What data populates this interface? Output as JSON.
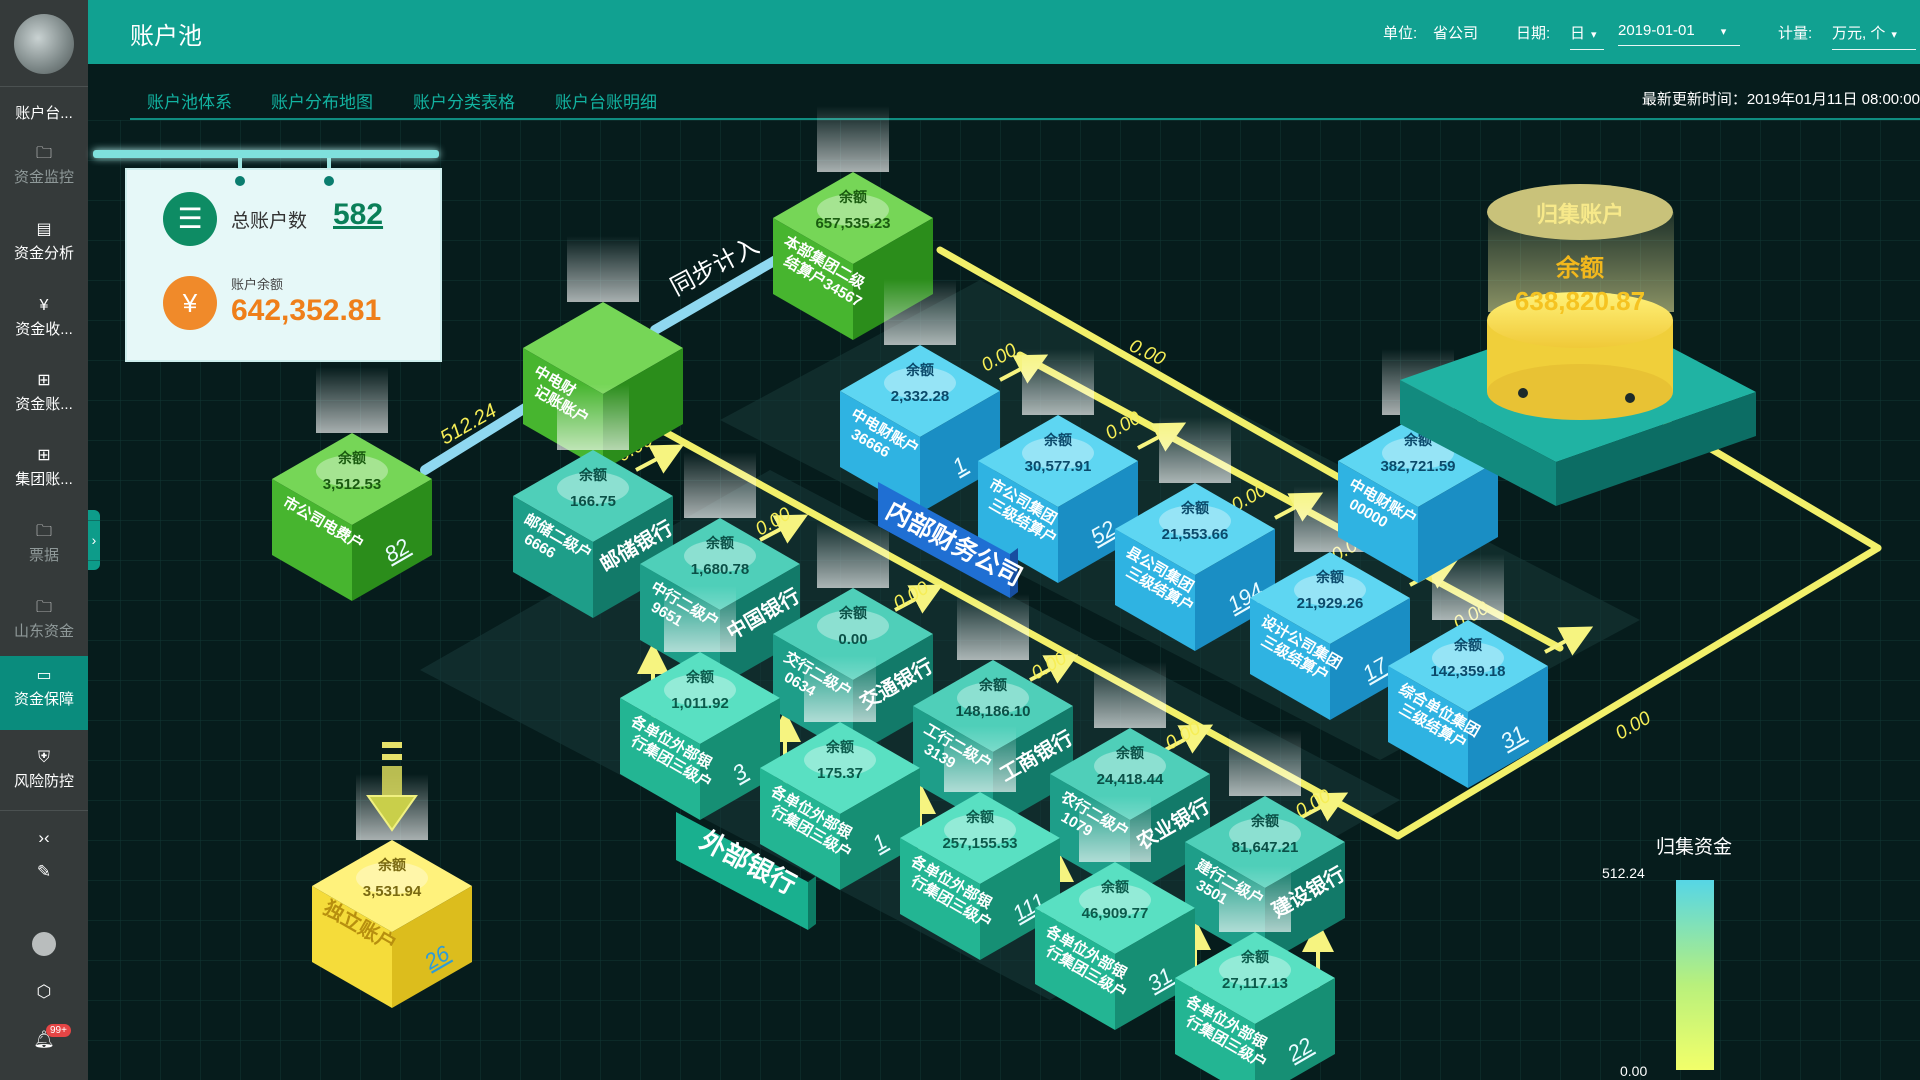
{
  "header": {
    "title": "账户池",
    "unit_label": "单位:",
    "unit_value": "省公司",
    "date_label": "日期:",
    "date_granularity": "日",
    "date_value": "2019-01-01",
    "measure_label": "计量:",
    "measure_value": "万元, 个"
  },
  "sidebar": {
    "items": [
      {
        "label": "账户台...",
        "icon": "ledger-icon",
        "active": false,
        "dim": false
      },
      {
        "label": "资金监控",
        "icon": "folder-icon",
        "active": false,
        "dim": true
      },
      {
        "label": "资金分析",
        "icon": "analysis-icon",
        "active": false,
        "dim": false
      },
      {
        "label": "资金收...",
        "icon": "money-icon",
        "active": false,
        "dim": false
      },
      {
        "label": "资金账...",
        "icon": "hierarchy-icon",
        "active": false,
        "dim": false
      },
      {
        "label": "集团账...",
        "icon": "hierarchy-icon",
        "active": false,
        "dim": false
      },
      {
        "label": "票据",
        "icon": "folder-icon",
        "active": false,
        "dim": true
      },
      {
        "label": "山东资金",
        "icon": "folder-icon",
        "active": false,
        "dim": true
      },
      {
        "label": "资金保障",
        "icon": "card-icon",
        "active": true,
        "dim": false
      },
      {
        "label": "风险防控",
        "icon": "shield-icon",
        "active": false,
        "dim": false
      }
    ],
    "notification_badge": "99+"
  },
  "tabs": [
    "账户池体系",
    "账户分布地图",
    "账户分类表格",
    "账户台账明细"
  ],
  "update_time": "最新更新时间：2019年01月11日 08:00:00",
  "summary": {
    "total_accounts_label": "总账户数",
    "total_accounts_value": "582",
    "balance_label": "账户余额",
    "balance_value": "642,352.81"
  },
  "collection_account": {
    "title": "归集账户",
    "balance_label": "余额",
    "balance_value": "638,820.87"
  },
  "flow_labels": {
    "sync_in": "同步计入",
    "internal_finance": "内部财务公司",
    "external_banks": "外部银行"
  },
  "balance_word": "余额",
  "boxes": [
    {
      "id": "city-fee",
      "name": "市公司电费户",
      "count": "82",
      "balance": "3,512.53",
      "color": "green"
    },
    {
      "id": "zhongdian-bookkeeping",
      "name": "中电财\n记账账户",
      "count": "",
      "balance": "",
      "color": "green"
    },
    {
      "id": "hq-settlement",
      "name": "本部集团二级\n结算户34567",
      "count": "",
      "balance": "657,535.23",
      "color": "green"
    },
    {
      "id": "postal-bank",
      "name": "邮储二级户\n6666",
      "bank": "邮储银行",
      "balance": "166.75",
      "color": "teal"
    },
    {
      "id": "boc",
      "name": "中行二级户\n9651",
      "bank": "中国银行",
      "balance": "1,680.78",
      "color": "teal"
    },
    {
      "id": "bocom",
      "name": "交行二级户\n0634",
      "bank": "交通银行",
      "balance": "0.00",
      "color": "teal"
    },
    {
      "id": "icbc",
      "name": "工行二级户\n3139",
      "bank": "工商银行",
      "balance": "148,186.10",
      "color": "teal"
    },
    {
      "id": "abc",
      "name": "农行二级户\n1079",
      "bank": "农业银行",
      "balance": "24,418.44",
      "color": "teal"
    },
    {
      "id": "ccb",
      "name": "建行二级户\n3501",
      "bank": "建设银行",
      "balance": "81,647.21",
      "color": "teal"
    },
    {
      "id": "ext-boc-grp",
      "name": "各单位外部银\n行集团三级户",
      "count": "3",
      "balance": "1,011.92",
      "color": "teal-light"
    },
    {
      "id": "ext-bocom-grp",
      "name": "各单位外部银\n行集团三级户",
      "count": "1",
      "balance": "175.37",
      "color": "teal-light"
    },
    {
      "id": "ext-icbc-grp",
      "name": "各单位外部银\n行集团三级户",
      "count": "111",
      "balance": "257,155.53",
      "color": "teal-light"
    },
    {
      "id": "ext-abc-grp",
      "name": "各单位外部银\n行集团三级户",
      "count": "31",
      "balance": "46,909.77",
      "color": "teal-light"
    },
    {
      "id": "ext-ccb-grp",
      "name": "各单位外部银\n行集团三级户",
      "count": "22",
      "balance": "27,117.13",
      "color": "teal-light"
    },
    {
      "id": "zd-finance",
      "name": "中电财账户\n36666",
      "count": "1",
      "balance": "2,332.28",
      "color": "blue"
    },
    {
      "id": "city-grp",
      "name": "市公司集团\n三级结算户",
      "count": "52",
      "balance": "30,577.91",
      "color": "blue"
    },
    {
      "id": "county-grp",
      "name": "县公司集团\n三级结算户",
      "count": "194",
      "balance": "21,553.66",
      "color": "blue"
    },
    {
      "id": "design-grp",
      "name": "设计公司集团\n三级结算户",
      "count": "17",
      "balance": "21,929.26",
      "color": "blue"
    },
    {
      "id": "general-grp",
      "name": "综合单位集团\n三级结算户",
      "count": "31",
      "balance": "142,359.18",
      "color": "blue"
    },
    {
      "id": "zd-main",
      "name": "中电财账户\n00000",
      "count": "",
      "balance": "382,721.59",
      "color": "blue"
    },
    {
      "id": "independent",
      "name": "独立账户",
      "count": "26",
      "balance": "3,531.94",
      "color": "yellow"
    }
  ],
  "flows": {
    "city_to_zd": "512.24",
    "zero": "0.00"
  },
  "legend": {
    "title": "归集资金",
    "max": "512.24",
    "min": "0.00"
  },
  "colors": {
    "header": "#11a191",
    "sidebar": "#353a3a",
    "accent": "#0a8c7d",
    "flow_yellow": "#f2f06a",
    "balance_orange": "#ef7f1a"
  }
}
